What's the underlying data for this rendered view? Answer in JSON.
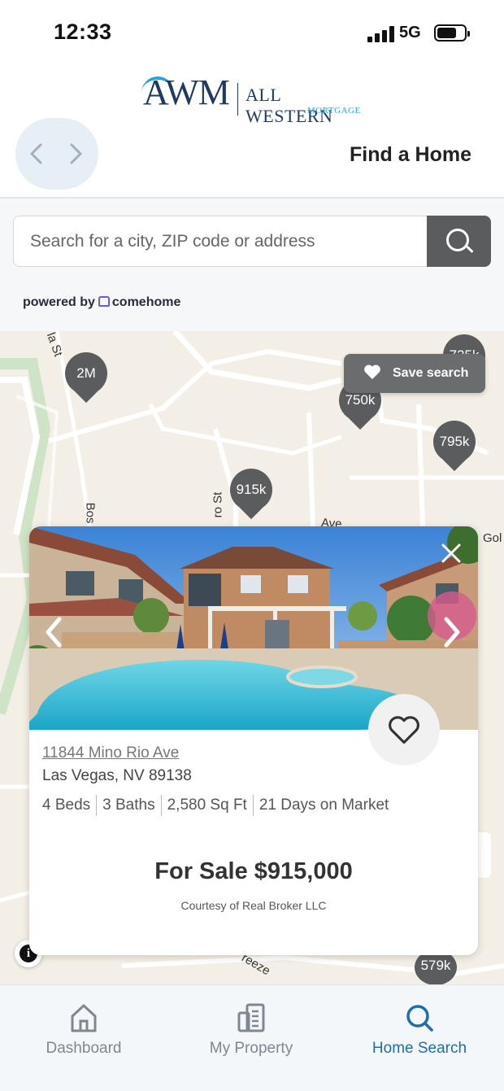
{
  "status_bar": {
    "time": "12:33",
    "network": "5G"
  },
  "header": {
    "logo_mark": "AWM",
    "logo_name": "ALL WESTERN",
    "logo_sub": "MORTGAGE",
    "title": "Find a Home",
    "back_icon": "chevron-left-icon",
    "forward_icon": "chevron-right-icon"
  },
  "search": {
    "placeholder": "Search for a city, ZIP code or address",
    "value": "",
    "button_icon": "search-icon",
    "powered_prefix": "powered by",
    "powered_brand": "comehome"
  },
  "map": {
    "save_search_label": "Save search",
    "pins": [
      "725k",
      "2M",
      "750k",
      "795k",
      "915k",
      "579k"
    ],
    "streets": [
      "la St",
      "Bos",
      "ro St",
      "Ave",
      "Gol",
      "reeze"
    ]
  },
  "listing": {
    "address": "11844 Mino Rio Ave",
    "city_state_zip": "Las Vegas, NV 89138",
    "facts": [
      "4 Beds",
      "3 Baths",
      "2,580 Sq Ft",
      "21 Days on Market"
    ],
    "price": "For Sale $915,000",
    "courtesy": "Courtesy of Real Broker LLC"
  },
  "bottom_nav": {
    "tabs": [
      {
        "label": "Dashboard",
        "icon": "home-icon",
        "active": false
      },
      {
        "label": "My Property",
        "icon": "building-icon",
        "active": false
      },
      {
        "label": "Home Search",
        "icon": "search-icon",
        "active": true
      }
    ]
  },
  "colors": {
    "accent": "#1e6fa8",
    "pin": "#5b5c5e",
    "map_bg": "#f4efe6",
    "logo_navy": "#1f3a5f",
    "logo_blue": "#2aa3d8"
  }
}
